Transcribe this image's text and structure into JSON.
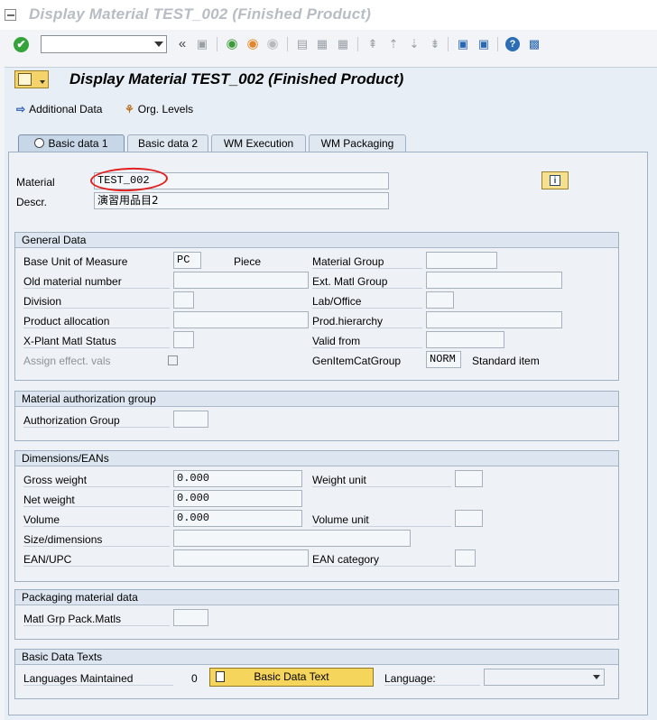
{
  "window": {
    "title": "Display Material TEST_002 (Finished Product)"
  },
  "toolbar": {
    "command_value": ""
  },
  "header": {
    "title": "Display Material TEST_002 (Finished Product)",
    "additional_data": "Additional Data",
    "org_levels": "Org. Levels"
  },
  "tabs": [
    {
      "label": "Basic data 1",
      "active": true
    },
    {
      "label": "Basic data 2",
      "active": false
    },
    {
      "label": "WM Execution",
      "active": false
    },
    {
      "label": "WM Packaging",
      "active": false
    }
  ],
  "material": {
    "label": "Material",
    "value": "TEST_002",
    "descr_label": "Descr.",
    "descr_value": "演習用品目2"
  },
  "general": {
    "title": "General Data",
    "base_uom_label": "Base Unit of Measure",
    "base_uom_value": "PC",
    "base_uom_text": "Piece",
    "material_group_label": "Material Group",
    "material_group_value": "",
    "old_material_label": "Old material number",
    "old_material_value": "",
    "ext_matl_group_label": "Ext. Matl Group",
    "ext_matl_group_value": "",
    "division_label": "Division",
    "division_value": "",
    "lab_office_label": "Lab/Office",
    "lab_office_value": "",
    "product_alloc_label": "Product allocation",
    "product_alloc_value": "",
    "prod_hierarchy_label": "Prod.hierarchy",
    "prod_hierarchy_value": "",
    "xplant_label": "X-Plant Matl Status",
    "xplant_value": "",
    "valid_from_label": "Valid from",
    "valid_from_value": "",
    "assign_label": "Assign effect. vals",
    "gen_item_label": "GenItemCatGroup",
    "gen_item_value": "NORM",
    "gen_item_text": "Standard item"
  },
  "auth": {
    "title": "Material authorization group",
    "auth_group_label": "Authorization Group",
    "auth_group_value": ""
  },
  "dims": {
    "title": "Dimensions/EANs",
    "gross_label": "Gross weight",
    "gross_value": "0.000",
    "weight_unit_label": "Weight unit",
    "weight_unit_value": "",
    "net_label": "Net weight",
    "net_value": "0.000",
    "volume_label": "Volume",
    "volume_value": "0.000",
    "volume_unit_label": "Volume unit",
    "volume_unit_value": "",
    "size_label": "Size/dimensions",
    "size_value": "",
    "ean_label": "EAN/UPC",
    "ean_value": "",
    "ean_cat_label": "EAN category",
    "ean_cat_value": ""
  },
  "packaging": {
    "title": "Packaging material data",
    "matl_grp_label": "Matl Grp Pack.Matls",
    "matl_grp_value": ""
  },
  "texts": {
    "title": "Basic Data Texts",
    "languages_label": "Languages Maintained",
    "languages_count": "0",
    "button_label": "Basic Data Text",
    "language_label": "Language:",
    "language_value": ""
  }
}
